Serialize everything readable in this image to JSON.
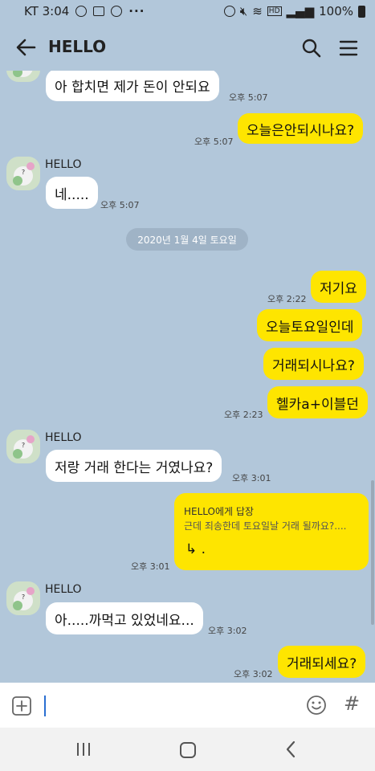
{
  "status": {
    "carrier_time": "KT 3:04",
    "hd": "HD",
    "battery": "100%"
  },
  "header": {
    "title": "HELLO"
  },
  "messages": {
    "m1_text": "아 합치면 제가 돈이 안되요",
    "m1_time": "오후 5:07",
    "m2_text": "오늘은안되시나요?",
    "m2_time": "오후 5:07",
    "sender": "HELLO",
    "m3_text": "네.....",
    "m3_time": "오후 5:07",
    "date_divider": "2020년 1월 4일 토요일",
    "m4_text": "저기요",
    "m4_time": "오후 2:22",
    "m5_text": "오늘토요일인데",
    "m6_text": "거래되시나요?",
    "m7_text": "헬카a+이블던",
    "m7_time": "오후 2:23",
    "m8_text": "저랑 거래 한다는 거였나요?",
    "m8_time": "오후 3:01",
    "reply_head": "HELLO에게 답장",
    "reply_quote": "근데 죄송한데 토요일날 거래 될까요?....",
    "reply_text": ".",
    "m9_time": "오후 3:01",
    "m10_text": "아.....까먹고 있었네요...",
    "m10_time": "오후 3:02",
    "m11_text": "거래되세요?",
    "m11_time": "오후 3:02"
  },
  "input": {
    "hash": "#"
  },
  "icons": {
    "back": "arrow-left-icon",
    "search": "search-icon",
    "menu": "hamburger-icon",
    "attach": "plus-square-icon",
    "emoji": "smiley-icon",
    "nav_recent": "recent-apps-icon",
    "nav_home": "home-icon",
    "nav_back": "chevron-left-icon"
  },
  "colors": {
    "background": "#b2c7da",
    "outgoing": "#fee500",
    "incoming": "#ffffff"
  }
}
